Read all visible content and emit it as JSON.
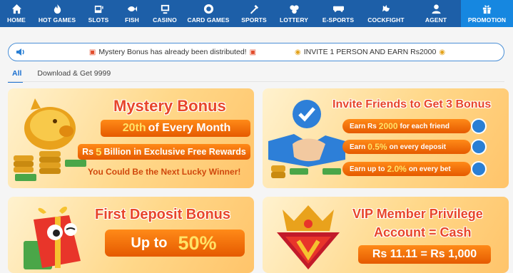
{
  "nav": [
    {
      "label": "HOME",
      "icon": "home-icon"
    },
    {
      "label": "HOT GAMES",
      "icon": "flame-icon"
    },
    {
      "label": "SLOTS",
      "icon": "slot-machine-icon"
    },
    {
      "label": "FISH",
      "icon": "fish-icon"
    },
    {
      "label": "CASINO",
      "icon": "casino-icon"
    },
    {
      "label": "CARD GAMES",
      "icon": "poker-chip-icon"
    },
    {
      "label": "SPORTS",
      "icon": "sports-icon"
    },
    {
      "label": "LOTTERY",
      "icon": "lottery-balls-icon"
    },
    {
      "label": "E-SPORTS",
      "icon": "gamepad-icon"
    },
    {
      "label": "COCKFIGHT",
      "icon": "rooster-icon"
    },
    {
      "label": "AGENT",
      "icon": "agent-icon"
    },
    {
      "label": "PROMOTION",
      "icon": "gift-icon"
    }
  ],
  "ticker": {
    "icon": "speaker-icon",
    "message1": "Mystery Bonus has already been distributed!",
    "message2": "INVITE 1 PERSON AND EARN Rs2000"
  },
  "tabs": [
    "All",
    "Download & Get 9999"
  ],
  "promos": {
    "mystery": {
      "title": "Mystery Bonus",
      "line1_a": "20th",
      "line1_b": "of Every Month",
      "line2_a": "Rs",
      "line2_b": "5",
      "line2_c": "Billion in Exclusive Free Rewards",
      "line3": "You Could Be the Next Lucky Winner!"
    },
    "invite": {
      "title": "Invite Friends to Get 3 Bonus",
      "row1_a": "Earn Rs",
      "row1_b": "2000",
      "row1_c": "for each friend",
      "row2_a": "Earn",
      "row2_b": "0.5%",
      "row2_c": "on every deposit",
      "row3_a": "Earn up to",
      "row3_b": "2.0%",
      "row3_c": "on every bet"
    },
    "first_deposit": {
      "title": "First Deposit Bonus",
      "up_to": "Up to",
      "percent": "50%"
    },
    "vip": {
      "title_line1": "VIP Member Privilege",
      "title_line2": "Account = Cash",
      "value": "Rs 11.11 = Rs 1,000"
    }
  },
  "colors": {
    "nav_bg": "#1d5fa8",
    "nav_active": "#1687e0",
    "title_red": "#e8462a",
    "pill_orange": "#ff7a0a",
    "tab_blue": "#1a6fd0"
  }
}
